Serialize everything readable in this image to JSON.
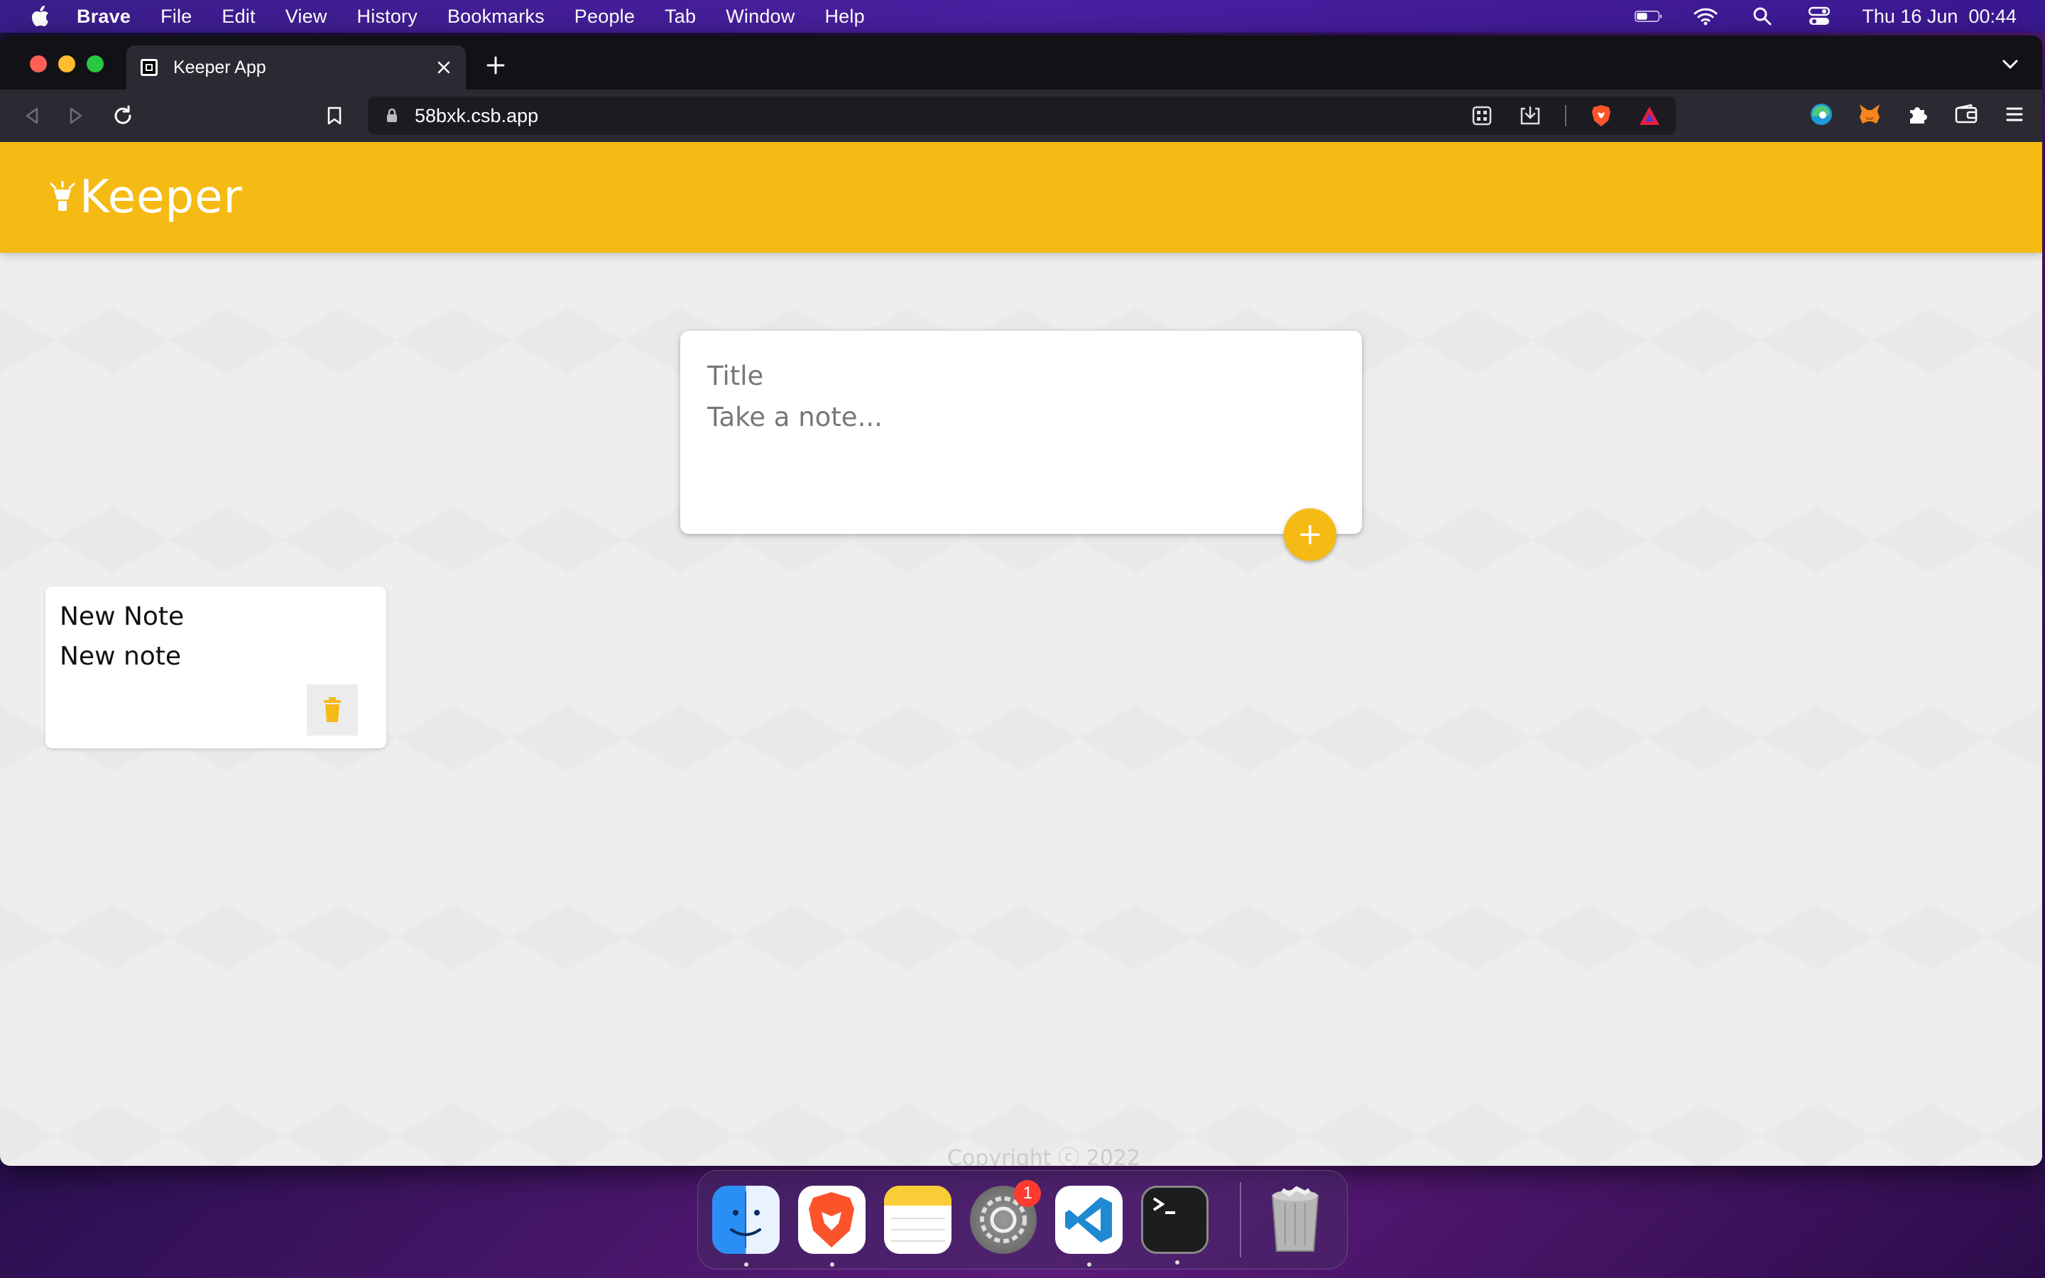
{
  "menubar": {
    "app_name": "Brave",
    "items": [
      "File",
      "Edit",
      "View",
      "History",
      "Bookmarks",
      "People",
      "Tab",
      "Window",
      "Help"
    ],
    "clock": "Thu 16 Jun  00:44",
    "icons": [
      "apple-icon",
      "battery-icon",
      "wifi-icon",
      "spotlight-search-icon",
      "control-center-icon"
    ]
  },
  "browser": {
    "tab_title": "Keeper App",
    "url": "58bxk.csb.app",
    "toolbar_icons": [
      "back-icon",
      "forward-icon",
      "reload-icon",
      "bookmark-icon",
      "lock-icon",
      "qr-code-icon",
      "download-icon",
      "brave-shields-icon",
      "brave-rewards-icon",
      "edge-extension-icon",
      "metamask-icon",
      "extensions-icon",
      "wallet-icon",
      "menu-icon"
    ]
  },
  "app": {
    "logo_text": "Keeper",
    "create_note": {
      "title_placeholder": "Title",
      "content_placeholder": "Take a note..."
    },
    "notes": [
      {
        "title": "New Note",
        "content": "New note"
      }
    ],
    "footer": "Copyright ⓒ 2022",
    "colors": {
      "accent": "#f5ba13",
      "page_background": "#eeeeee"
    }
  },
  "dock": {
    "apps": [
      "Finder",
      "Brave Browser",
      "Notes",
      "System Preferences",
      "Visual Studio Code",
      "Terminal",
      "Trash"
    ],
    "system_preferences_badge": "1"
  }
}
